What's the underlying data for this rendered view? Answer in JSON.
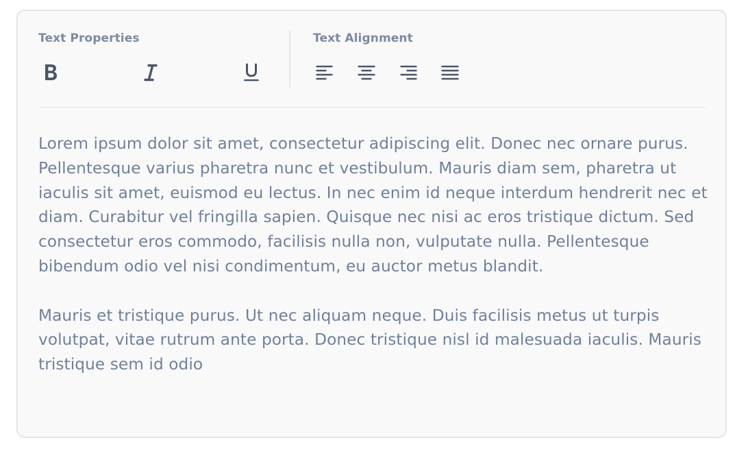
{
  "toolbar": {
    "text_properties_label": "Text Properties",
    "text_alignment_label": "Text Alignment",
    "icon_color": "#4a5568"
  },
  "editor": {
    "paragraphs": [
      "Lorem ipsum dolor sit amet, consectetur adipiscing elit. Donec nec ornare purus. Pellentesque varius pharetra nunc et vestibulum. Mauris diam sem, pharetra ut iaculis sit amet, euismod eu lectus. In nec enim id neque interdum hendrerit nec et diam. Curabitur vel fringilla sapien. Quisque nec nisi ac eros tristique dictum. Sed consectetur eros commodo, facilisis nulla non, vulputate nulla. Pellentesque bibendum odio vel nisi condimentum, eu auctor metus blandit.",
      "Mauris et tristique purus. Ut nec aliquam neque. Duis facilisis metus ut turpis volutpat, vitae rutrum ante porta. Donec tristique nisl id malesuada iaculis. Mauris tristique sem id odio"
    ],
    "text_color": "#71809a"
  }
}
